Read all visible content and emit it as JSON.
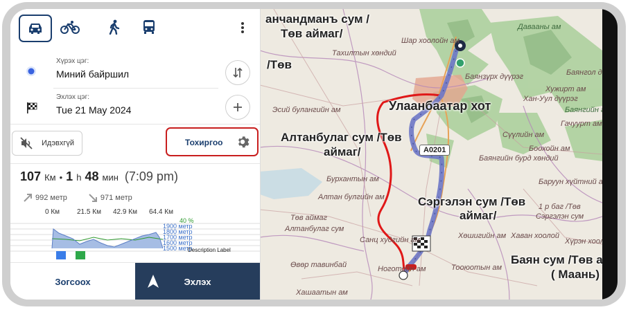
{
  "modes": [
    {
      "name": "car",
      "icon": "car-icon",
      "active": true
    },
    {
      "name": "bike",
      "icon": "bicycle-icon",
      "active": false
    },
    {
      "name": "walk",
      "icon": "pedestrian-icon",
      "active": false
    },
    {
      "name": "bus",
      "icon": "bus-icon",
      "active": false
    }
  ],
  "route_points": {
    "destination": {
      "caption": "Хүрэх цэг:",
      "value": "Миний байршил"
    },
    "start": {
      "caption": "Эхлэх цэг:",
      "value": "Tue 21 May 2024"
    }
  },
  "options": {
    "mute_label": "Идэвхгүй",
    "settings_label": "Тохиргоо"
  },
  "summary": {
    "distance_value": "107",
    "distance_unit": "Км",
    "dot": "•",
    "hours": "1",
    "hours_unit": "h",
    "minutes": "48",
    "minutes_unit": "мин",
    "arrival": "(7:09 pm)",
    "ascent": "992 метр",
    "descent": "971 метр"
  },
  "chart": {
    "x_ticks": [
      "0 Км",
      "21.5 Км",
      "42.9 Км",
      "64.4 Км"
    ],
    "right_labels": [
      "40 %",
      "1900 метр",
      "1800 метр",
      "1700 метр",
      "1600 метр",
      "1500 метр"
    ],
    "description": "Description Label"
  },
  "bottom": {
    "stop_label": "Зогсоох",
    "start_label": "Эхлэх"
  },
  "map": {
    "labels": {
      "l1": "анчандманъ сум /",
      "l2": "Төв аймаг/",
      "l3": "/Төв",
      "city": "Улаанбаатар хот",
      "altan": "Алтанбулаг сум /Төв",
      "altan2": "аймаг/",
      "sergelen": "Сэргэлэн сум /Төв",
      "sergelen2": "аймаг/",
      "bayan": "Баян сум /Төв а",
      "bayan2": "( Маань)"
    },
    "small": [
      "Шар хоолойн ам",
      "Тахилтын хөндий",
      "Баянзүрх дүүрэг",
      "Баянгол дүүрэг",
      "Хужирт ам",
      "Хан-Уул дүүрэг",
      "Эсий булангийн ам",
      "Бурхантын ам",
      "Алтан булгийн ам",
      "Төв аймаг",
      "Алтанбулаг сум",
      "Санц худгийн ам",
      "Өвөр тавинбай",
      "Ноготойн ам",
      "Хашаатын ам",
      "Давааны ам",
      "Баянгийн ам",
      "Сүүлийн ам",
      "Боохойн ам",
      "Баянгийн бурд хөндий",
      "Гачуурт ам",
      "Баруун хүйтний ам",
      "1 р баг /Төв",
      "Сэргэлэн сум",
      "Хаван хоолой",
      "Хөшигийн ам",
      "Тооюотын ам",
      "Хүрэн хоолой"
    ],
    "road": "A0201",
    "accent": "#d8181e",
    "route_color": "#6d77c6"
  }
}
